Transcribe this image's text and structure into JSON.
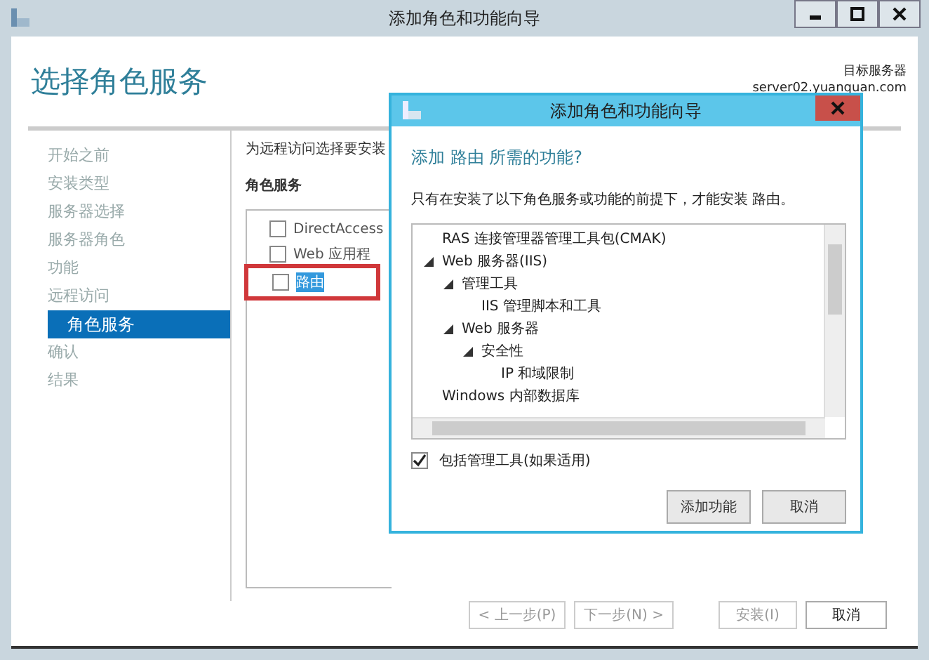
{
  "window": {
    "title": "添加角色和功能向导"
  },
  "page": {
    "heading": "选择角色服务",
    "target_label": "目标服务器",
    "target_server": "server02.yuanquan.com"
  },
  "nav": [
    {
      "label": "开始之前",
      "selected": false
    },
    {
      "label": "安装类型",
      "selected": false
    },
    {
      "label": "服务器选择",
      "selected": false
    },
    {
      "label": "服务器角色",
      "selected": false
    },
    {
      "label": "功能",
      "selected": false
    },
    {
      "label": "远程访问",
      "selected": false,
      "children": [
        {
          "label": "角色服务",
          "selected": true
        }
      ]
    },
    {
      "label": "确认",
      "selected": false
    },
    {
      "label": "结果",
      "selected": false
    }
  ],
  "content": {
    "intro": "为远程访问选择要安装",
    "list_title": "角色服务",
    "role_services": [
      {
        "label": "DirectAccess",
        "checked": false,
        "selected": false
      },
      {
        "label": "Web 应用程",
        "checked": false,
        "selected": false
      },
      {
        "label": "路由",
        "checked": false,
        "selected": true
      }
    ]
  },
  "dialog": {
    "title": "添加角色和功能向导",
    "heading": "添加 路由 所需的功能?",
    "message": "只有在安装了以下角色服务或功能的前提下，才能安装 路由。",
    "features": [
      {
        "label": "RAS 连接管理器管理工具包(CMAK)"
      },
      {
        "label": "Web 服务器(IIS)",
        "expanded": true,
        "children": [
          {
            "label": "管理工具",
            "expanded": true,
            "children": [
              {
                "label": "IIS 管理脚本和工具"
              }
            ]
          },
          {
            "label": "Web 服务器",
            "expanded": true,
            "children": [
              {
                "label": "安全性",
                "expanded": true,
                "children": [
                  {
                    "label": "IP 和域限制"
                  }
                ]
              }
            ]
          }
        ]
      },
      {
        "label": "Windows 内部数据库"
      }
    ],
    "include_tools": {
      "label": "包括管理工具(如果适用)",
      "checked": true
    },
    "buttons": [
      "添加功能",
      "取消"
    ]
  },
  "footer_buttons": [
    {
      "label": "< 上一步(P)",
      "disabled": true
    },
    {
      "label": "下一步(N) >",
      "disabled": true
    },
    {
      "label": "安装(I)",
      "disabled": true
    },
    {
      "label": "取消",
      "disabled": false
    }
  ]
}
